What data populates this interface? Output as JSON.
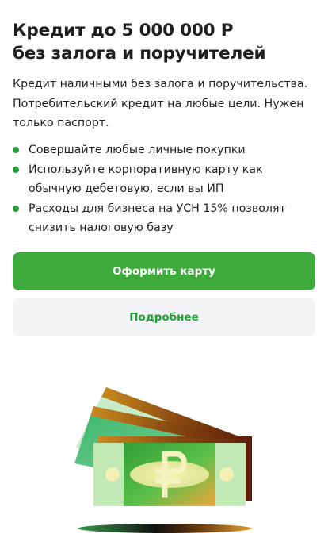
{
  "promo": {
    "title_line1": "Кредит до 5 000 000 Р",
    "title_line2": "без залога и поручителей",
    "description": "Кредит наличными без залога и поручительства. Потребительский кредит на любые цели. Нужен только паспорт.",
    "bullets": [
      "Совершайте любые личные покупки",
      "Используйте корпоративную карту как обычную дебетовую, если вы ИП",
      "Расходы для бизнеса на УСН 15% позволят снизить налоговую базу"
    ],
    "primary_button": "Оформить карту",
    "secondary_button": "Подробнее",
    "accent_color": "#21a038",
    "primary_button_color": "#3faa3c",
    "illustration_icon": "money-banknotes-ruble-icon",
    "currency_symbol": "₽"
  }
}
